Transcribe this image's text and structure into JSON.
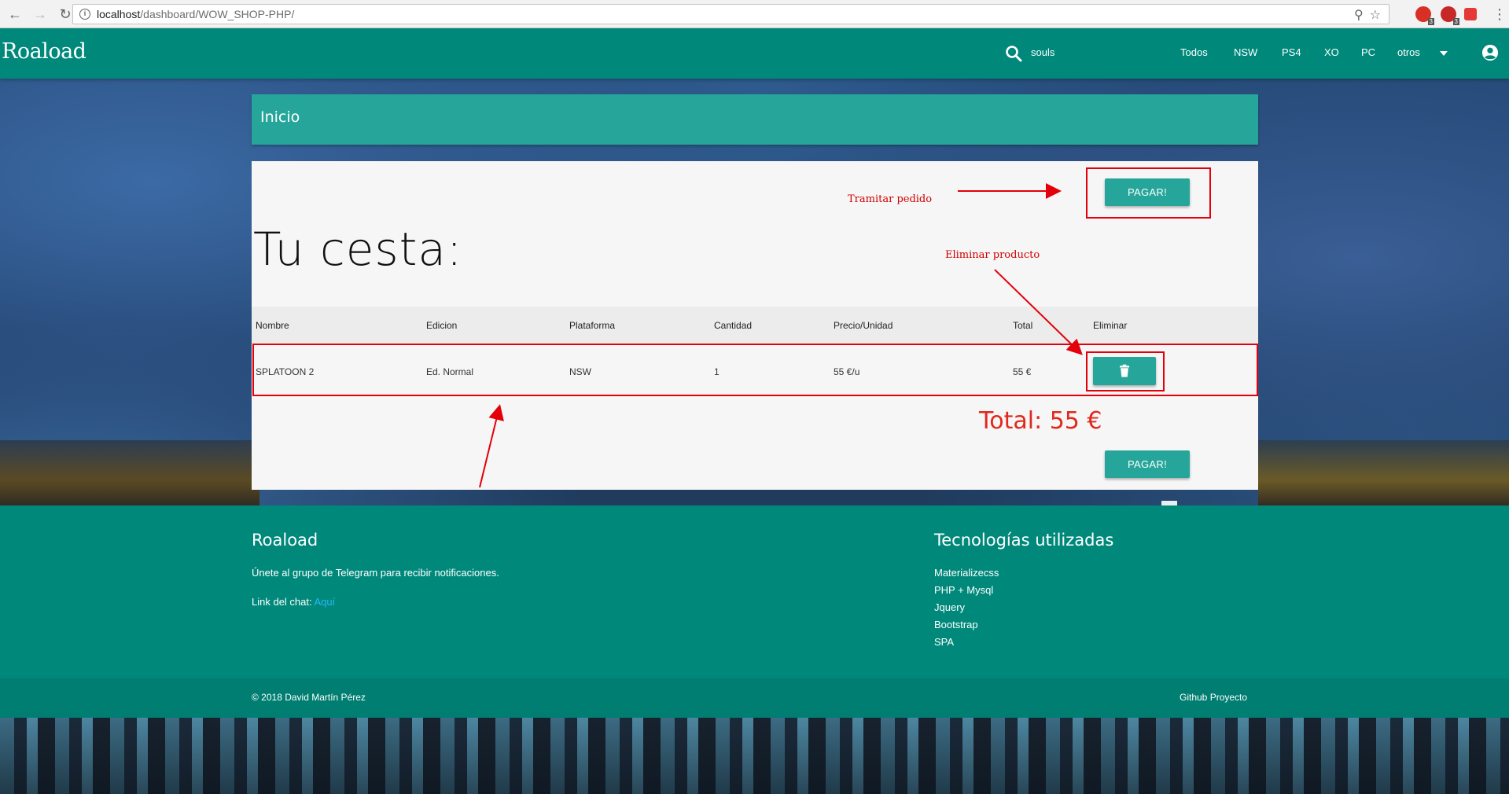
{
  "browser": {
    "url_host": "localhost",
    "url_path": "/dashboard/WOW_SHOP-PHP/",
    "ext_badge_1": "3",
    "ext_badge_2": "3"
  },
  "navbar": {
    "brand": "Roaload",
    "search_text": "souls",
    "links": [
      "Todos",
      "NSW",
      "PS4",
      "XO",
      "PC",
      "otros"
    ]
  },
  "breadcrumb": {
    "label": "Inicio"
  },
  "cart": {
    "pay_label": "PAGAR!",
    "heading": "Tu cesta:",
    "columns": [
      "Nombre",
      "Edicion",
      "Plataforma",
      "Cantidad",
      "Precio/Unidad",
      "Total",
      "Eliminar"
    ],
    "rows": [
      {
        "nombre": "SPLATOON 2",
        "edicion": "Ed. Normal",
        "plataforma": "NSW",
        "cantidad": "1",
        "precio": "55 €/u",
        "total": "55 €"
      }
    ],
    "total_label": "Total: 55 €"
  },
  "annotations": {
    "tramitar": "Tramitar pedido",
    "eliminar": "Eliminar producto"
  },
  "footer": {
    "left_title": "Roaload",
    "telegram_text": "Únete al grupo de Telegram para recibir notificaciones.",
    "chat_label": "Link del chat:",
    "chat_link": "Aquí",
    "right_title": "Tecnologías utilizadas",
    "techs": [
      "Materializecss",
      "PHP + Mysql",
      "Jquery",
      "Bootstrap",
      "SPA"
    ],
    "copyright": "© 2018 David Martín Pérez",
    "github": "Github Proyecto"
  },
  "colors": {
    "primary": "#00897b",
    "accent": "#26a69a",
    "annotation": "#e3000b",
    "total": "#e0291d"
  }
}
